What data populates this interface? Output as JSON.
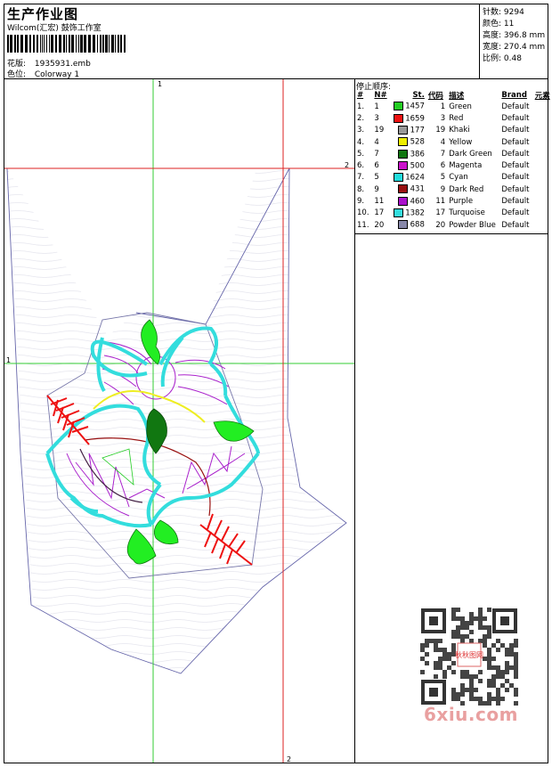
{
  "header": {
    "title": "生产作业图",
    "company": "Wilcom(汇宏) 鼓饰工作室",
    "design_label": "花版:",
    "design_value": "1935931.emb",
    "colorway_label": "色位:",
    "colorway_value": "Colorway 1"
  },
  "stats": [
    {
      "label": "针数:",
      "value": "9294"
    },
    {
      "label": "颜色:",
      "value": "11"
    },
    {
      "label": "高度:",
      "value": "396.8 mm"
    },
    {
      "label": "宽度:",
      "value": "270.4 mm"
    },
    {
      "label": "比例:",
      "value": "0.48"
    }
  ],
  "sequence": {
    "title": "停止顺序:",
    "columns": [
      "#",
      "N#",
      "St.",
      "代码",
      "描述",
      "Brand",
      "元素"
    ],
    "rows": [
      {
        "seq": "1.",
        "n": "1",
        "color": "#22cc22",
        "st": "1457",
        "code": "1",
        "desc": "Green",
        "brand": "Default"
      },
      {
        "seq": "2.",
        "n": "3",
        "color": "#ee1111",
        "st": "1659",
        "code": "3",
        "desc": "Red",
        "brand": "Default"
      },
      {
        "seq": "3.",
        "n": "19",
        "color": "#999999",
        "st": "177",
        "code": "19",
        "desc": "Khaki",
        "brand": "Default"
      },
      {
        "seq": "4.",
        "n": "4",
        "color": "#eeee00",
        "st": "528",
        "code": "4",
        "desc": "Yellow",
        "brand": "Default"
      },
      {
        "seq": "5.",
        "n": "7",
        "color": "#117711",
        "st": "386",
        "code": "7",
        "desc": "Dark Green",
        "brand": "Default"
      },
      {
        "seq": "6.",
        "n": "6",
        "color": "#cc11cc",
        "st": "500",
        "code": "6",
        "desc": "Magenta",
        "brand": "Default"
      },
      {
        "seq": "7.",
        "n": "5",
        "color": "#22dddd",
        "st": "1624",
        "code": "5",
        "desc": "Cyan",
        "brand": "Default"
      },
      {
        "seq": "8.",
        "n": "9",
        "color": "#991111",
        "st": "431",
        "code": "9",
        "desc": "Dark Red",
        "brand": "Default"
      },
      {
        "seq": "9.",
        "n": "11",
        "color": "#aa11cc",
        "st": "460",
        "code": "11",
        "desc": "Purple",
        "brand": "Default"
      },
      {
        "seq": "10.",
        "n": "17",
        "color": "#33dddd",
        "st": "1382",
        "code": "17",
        "desc": "Turquoise",
        "brand": "Default"
      },
      {
        "seq": "11.",
        "n": "20",
        "color": "#8888aa",
        "st": "688",
        "code": "20",
        "desc": "Powder Blue",
        "brand": "Default"
      }
    ]
  },
  "guides": {
    "v1": "1",
    "h1": "1",
    "h2": "2",
    "v2": "2"
  },
  "watermark": "6xiu.com",
  "qr_badge": "秋秋图网"
}
